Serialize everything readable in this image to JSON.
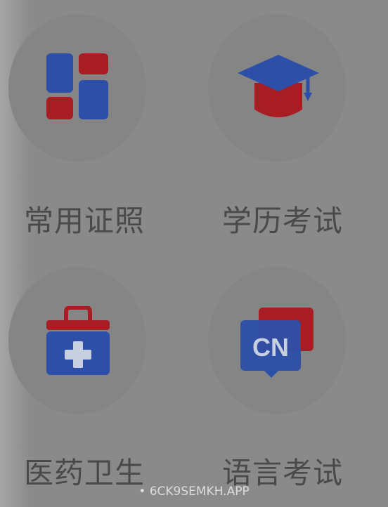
{
  "grid": {
    "items": [
      {
        "label": "常用证照",
        "icon": "certificates-grid-icon"
      },
      {
        "label": "学历考试",
        "icon": "graduation-cap-icon"
      },
      {
        "label": "医药卫生",
        "icon": "medical-kit-icon"
      },
      {
        "label": "语言考试",
        "icon": "language-cn-icon",
        "icon_text": "CN"
      }
    ]
  },
  "footer": {
    "text": "• 6CK9SEMKH.APP"
  },
  "colors": {
    "blue": "#2d4fa8",
    "red": "#a81d24",
    "overlay": "#8a8a8a"
  }
}
